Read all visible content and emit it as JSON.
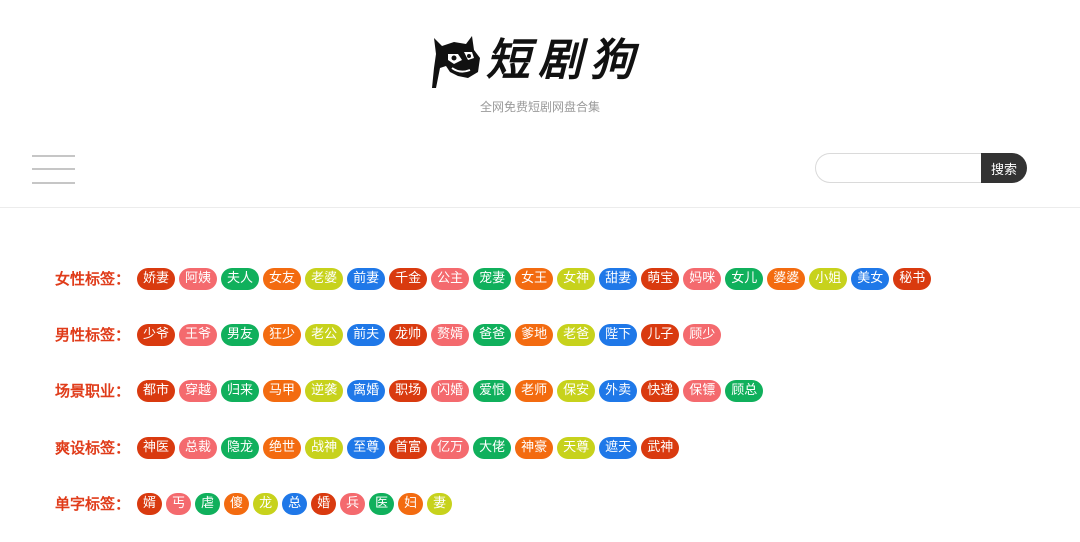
{
  "site": {
    "logo_text": "短剧狗",
    "tagline": "全网免费短剧网盘合集"
  },
  "search": {
    "placeholder": "",
    "button_label": "搜索"
  },
  "colors": [
    "#d93a0f",
    "#f46a6e",
    "#10b05c",
    "#f36b10",
    "#c7d21c",
    "#1f78e8"
  ],
  "rows": [
    {
      "label": "女性标签：",
      "tags": [
        "娇妻",
        "阿姨",
        "夫人",
        "女友",
        "老婆",
        "前妻",
        "千金",
        "公主",
        "宠妻",
        "女王",
        "女神",
        "甜妻",
        "萌宝",
        "妈咪",
        "女儿",
        "婆婆",
        "小姐",
        "美女",
        "秘书"
      ]
    },
    {
      "label": "男性标签：",
      "tags": [
        "少爷",
        "王爷",
        "男友",
        "狂少",
        "老公",
        "前夫",
        "龙帅",
        "赘婿",
        "爸爸",
        "爹地",
        "老爸",
        "陛下",
        "儿子",
        "顾少"
      ]
    },
    {
      "label": "场景职业：",
      "tags": [
        "都市",
        "穿越",
        "归来",
        "马甲",
        "逆袭",
        "离婚",
        "职场",
        "闪婚",
        "爱恨",
        "老师",
        "保安",
        "外卖",
        "快递",
        "保镖",
        "顾总"
      ]
    },
    {
      "label": "爽设标签：",
      "tags": [
        "神医",
        "总裁",
        "隐龙",
        "绝世",
        "战神",
        "至尊",
        "首富",
        "亿万",
        "大佬",
        "神豪",
        "天尊",
        "遮天",
        "武神"
      ]
    },
    {
      "label": "单字标签：",
      "tags": [
        "婿",
        "丐",
        "虐",
        "傻",
        "龙",
        "总",
        "婚",
        "兵",
        "医",
        "妇",
        "妻"
      ]
    }
  ]
}
